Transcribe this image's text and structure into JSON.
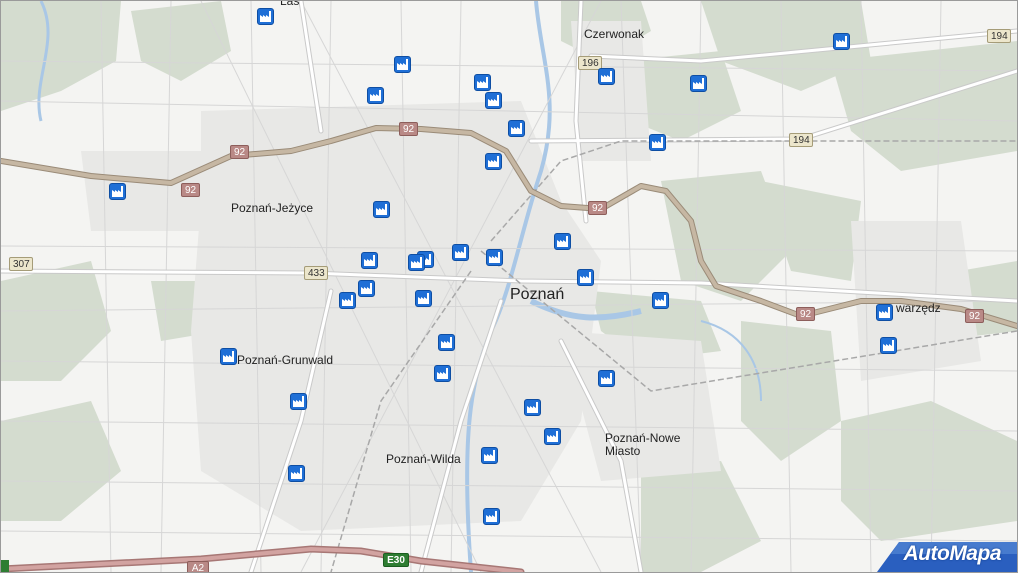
{
  "map": {
    "places": [
      {
        "id": "las",
        "text": "Las"
      },
      {
        "id": "czerwonak",
        "text": "Czerwonak"
      },
      {
        "id": "jezyce",
        "text": "Poznań-Jeżyce"
      },
      {
        "id": "poznan",
        "text": "Poznań"
      },
      {
        "id": "grunwald",
        "text": "Poznań-Grunwald"
      },
      {
        "id": "wilda",
        "text": "Poznań-Wilda"
      },
      {
        "id": "nowe-miasto",
        "text": "Poznań-Nowe",
        "text2": "Miasto"
      },
      {
        "id": "swarzedz",
        "text": "warzędz"
      }
    ],
    "road_shields": [
      {
        "id": "r92a",
        "text": "92"
      },
      {
        "id": "r92b",
        "text": "92"
      },
      {
        "id": "r92c",
        "text": "92"
      },
      {
        "id": "r92d",
        "text": "92"
      },
      {
        "id": "r92e",
        "text": "92"
      },
      {
        "id": "r92f",
        "text": "92"
      },
      {
        "id": "r196",
        "text": "196"
      },
      {
        "id": "r194a",
        "text": "194"
      },
      {
        "id": "r194b",
        "text": "194"
      },
      {
        "id": "r307",
        "text": "307"
      },
      {
        "id": "r433",
        "text": "433"
      },
      {
        "id": "a2",
        "text": "A2"
      },
      {
        "id": "e30",
        "text": "E30"
      }
    ],
    "poi_icon": "factory-icon",
    "poi_count": 36,
    "logo_text": "AutoMapa",
    "colors": {
      "background": "#f4f4f2",
      "forest": "#d5ddd0",
      "water": "#a9c7e6",
      "national_road": "#b8a896",
      "highway": "#c79a99",
      "poi": "#1f6fd6",
      "logo": "#1a4fa8"
    }
  }
}
